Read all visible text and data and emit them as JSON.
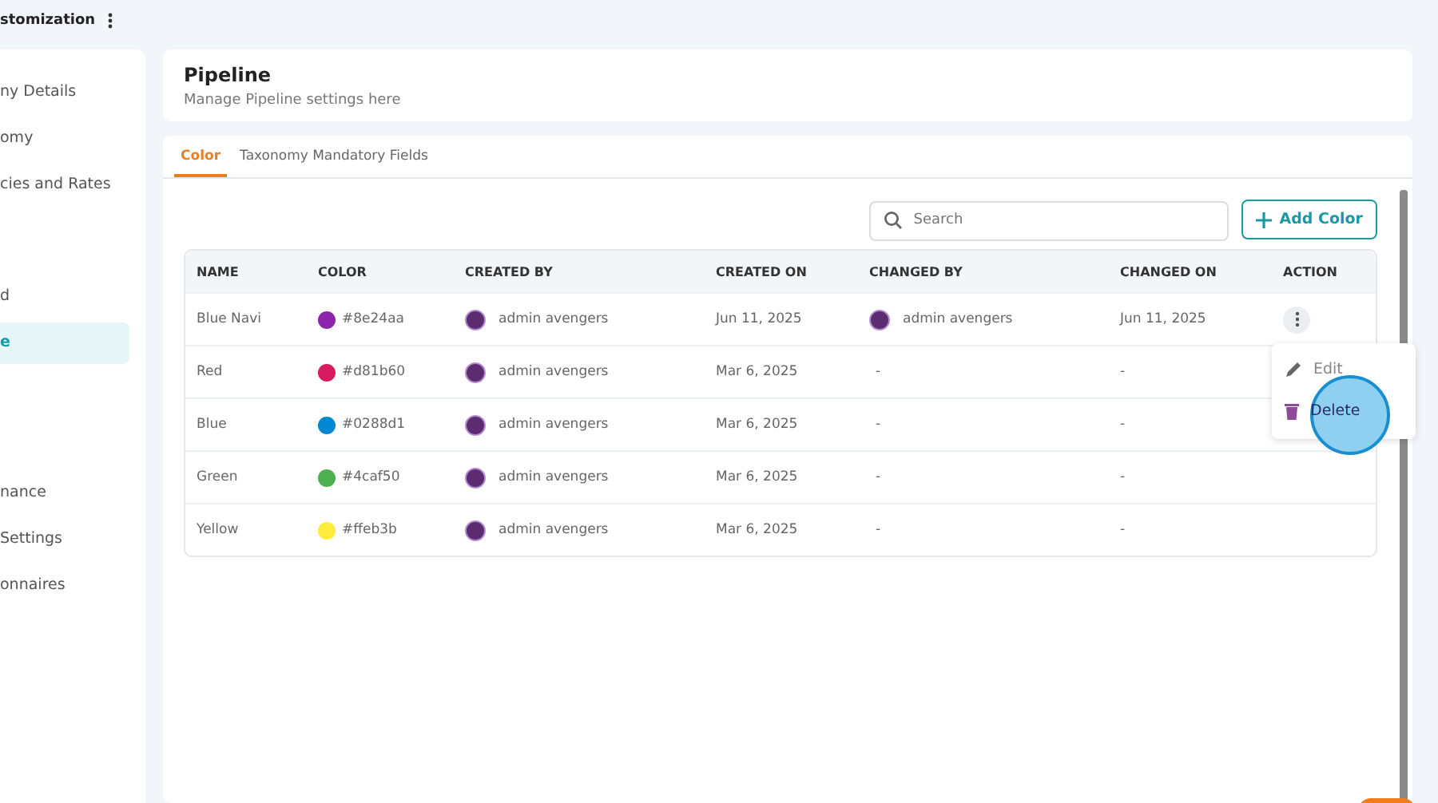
{
  "header": {
    "title": "stomization"
  },
  "sidebar": {
    "groups": [
      [
        {
          "label": "ny Details",
          "selected": false
        },
        {
          "label": "omy",
          "selected": false
        },
        {
          "label": "cies and Rates",
          "selected": false
        }
      ],
      [
        {
          "label": "d",
          "selected": false
        },
        {
          "label": "e",
          "selected": true
        }
      ],
      [
        {
          "label": "nance",
          "selected": false
        },
        {
          "label": " Settings",
          "selected": false
        },
        {
          "label": "onnaires",
          "selected": false
        }
      ]
    ]
  },
  "page": {
    "title": "Pipeline",
    "subtitle": "Manage Pipeline settings here"
  },
  "tabs": [
    {
      "label": "Color",
      "selected": true
    },
    {
      "label": "Taxonomy Mandatory Fields",
      "selected": false
    }
  ],
  "search": {
    "placeholder": "Search"
  },
  "add_button": "Add Color",
  "table": {
    "columns": [
      "NAME",
      "COLOR",
      "CREATED BY",
      "CREATED ON",
      "CHANGED BY",
      "CHANGED ON",
      "ACTION"
    ],
    "rows": [
      {
        "name": "Blue Navi",
        "color": "#8e24aa",
        "color_label": "#8e24aa",
        "created_by": "admin avengers",
        "created_on": "Jun 11, 2025",
        "changed_by": "admin avengers",
        "changed_on": "Jun 11, 2025",
        "menu_open": true
      },
      {
        "name": "Red",
        "color": "#d81b60",
        "color_label": "#d81b60",
        "created_by": "admin avengers",
        "created_on": "Mar 6, 2025",
        "changed_by": "-",
        "changed_on": "-",
        "menu_open": false
      },
      {
        "name": "Blue",
        "color": "#0288d1",
        "color_label": "#0288d1",
        "created_by": "admin avengers",
        "created_on": "Mar 6, 2025",
        "changed_by": "-",
        "changed_on": "-",
        "menu_open": false
      },
      {
        "name": "Green",
        "color": "#4caf50",
        "color_label": "#4caf50",
        "created_by": "admin avengers",
        "created_on": "Mar 6, 2025",
        "changed_by": "-",
        "changed_on": "-",
        "menu_open": false
      },
      {
        "name": "Yellow",
        "color": "#ffeb3b",
        "color_label": "#ffeb3b",
        "created_by": "admin avengers",
        "created_on": "Mar 6, 2025",
        "changed_by": "-",
        "changed_on": "-",
        "menu_open": false
      }
    ]
  },
  "row_menu": [
    {
      "kind": "edit",
      "label": "Edit",
      "selected": false
    },
    {
      "kind": "delete",
      "label": "Delete",
      "selected": true
    }
  ]
}
